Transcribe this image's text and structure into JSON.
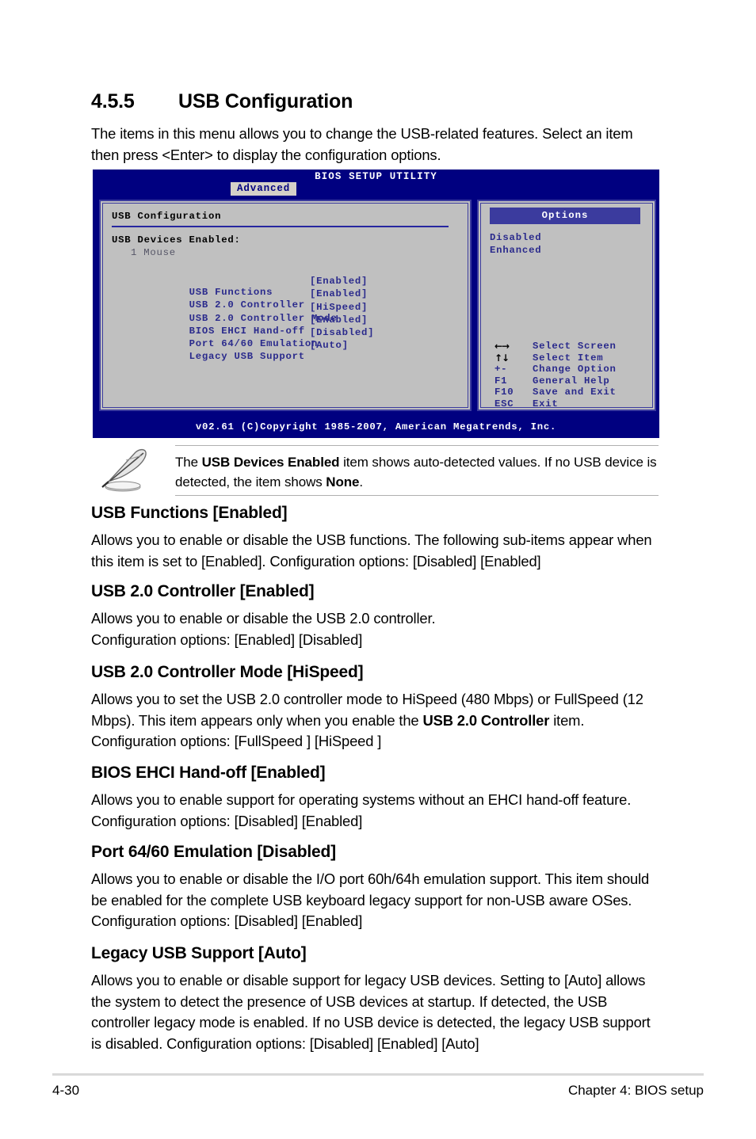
{
  "section": {
    "number": "4.5.5",
    "title": "USB Configuration",
    "intro": "The items in this menu allows you to change the USB-related features. Select an item then press <Enter> to display the configuration options."
  },
  "bios": {
    "title": "BIOS SETUP UTILITY",
    "tab": "Advanced",
    "panel_title": "USB Configuration",
    "devices_label": "USB Devices Enabled:",
    "devices_value": "1 Mouse",
    "items": [
      {
        "label": "USB Functions",
        "value": "[Enabled]"
      },
      {
        "label": "USB 2.0 Controller",
        "value": "[Enabled]"
      },
      {
        "label": "USB 2.0 Controller Mode",
        "value": "[HiSpeed]"
      },
      {
        "label": "BIOS EHCI Hand-off",
        "value": "[Enabled]"
      },
      {
        "label": "Port 64/60 Emulation",
        "value": "[Disabled]"
      },
      {
        "label": "Legacy USB Support",
        "value": "[Auto]"
      }
    ],
    "options_header": "Options",
    "options": [
      "Disabled",
      "Enhanced"
    ],
    "keys": [
      {
        "key": "←→",
        "desc": "Select Screen",
        "glyph": true
      },
      {
        "key": "↑↓",
        "desc": "Select Item",
        "glyph": true
      },
      {
        "key": "+-",
        "desc": "Change Option",
        "glyph": false
      },
      {
        "key": "F1",
        "desc": "General Help",
        "glyph": false
      },
      {
        "key": "F10",
        "desc": "Save and Exit",
        "glyph": false
      },
      {
        "key": "ESC",
        "desc": "Exit",
        "glyph": false
      }
    ],
    "copyright": "v02.61 (C)Copyright 1985-2007, American Megatrends, Inc.",
    "colors": {
      "header_bg": "#000080",
      "panel_bg": "#c0c0c0",
      "panel_border": "#3b3b9e",
      "text": "#2a2a8c",
      "highlight_bg": "#3b3b9e",
      "tab_bg": "#d4d0c8"
    }
  },
  "note": {
    "prefix": "The ",
    "bold1": "USB Devices Enabled",
    "middle": " item shows auto-detected values. If no USB device is detected, the item shows ",
    "bold2": "None",
    "suffix": "."
  },
  "blocks": [
    {
      "heading": "USB Functions [Enabled]",
      "body": "Allows you to enable or disable the USB functions. The following sub-items appear when this item is set to [Enabled]. Configuration options: [Disabled] [Enabled]"
    },
    {
      "heading": "USB 2.0 Controller [Enabled]",
      "body": "Allows you to enable or disable the USB 2.0 controller.\nConfiguration options: [Enabled] [Disabled]"
    },
    {
      "heading": "USB 2.0 Controller Mode [HiSpeed]",
      "body_part1": "Allows you to set the USB 2.0 controller mode to HiSpeed (480 Mbps) or FullSpeed (12 Mbps). This item appears only when you enable the ",
      "body_bold": "USB 2.0 Controller",
      "body_part2": " item. Configuration options: [FullSpeed ] [HiSpeed ]"
    },
    {
      "heading": "BIOS EHCI Hand-off [Enabled]",
      "body": "Allows you to enable support for operating systems without an EHCI hand-off feature. Configuration options: [Disabled] [Enabled]"
    },
    {
      "heading": "Port 64/60 Emulation [Disabled]",
      "body": "Allows you to enable or disable the I/O port 60h/64h emulation support. This item should be enabled for the complete USB keyboard legacy support for non-USB aware OSes. Configuration options: [Disabled] [Enabled]"
    },
    {
      "heading": "Legacy USB Support [Auto]",
      "body": "Allows you to enable or disable support for legacy USB devices. Setting to [Auto] allows the system to detect the presence of USB devices at startup. If detected, the USB controller legacy mode is enabled. If no USB device is detected, the legacy USB support is disabled. Configuration options: [Disabled] [Enabled] [Auto]"
    }
  ],
  "footer": {
    "page": "4-30",
    "chapter": "Chapter 4: BIOS setup"
  }
}
